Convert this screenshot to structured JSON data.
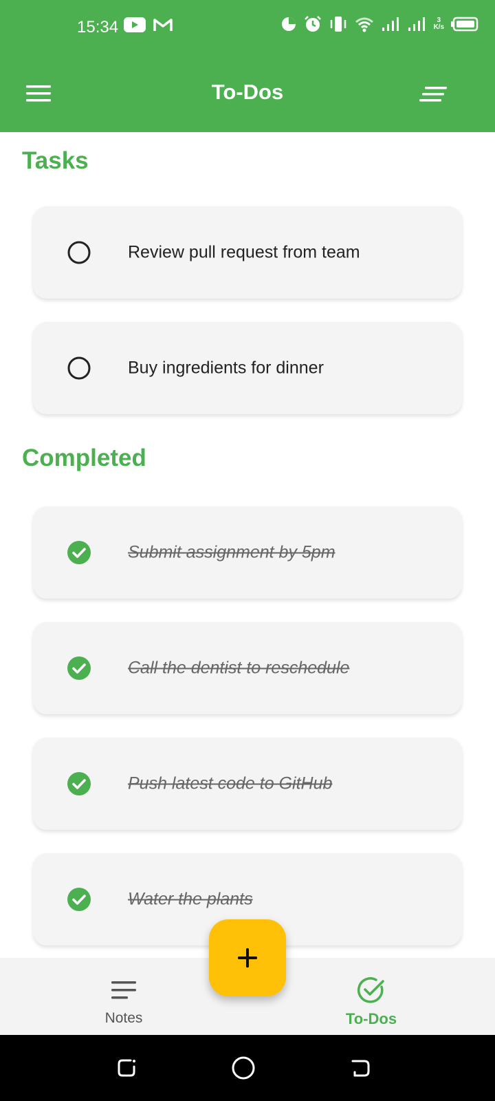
{
  "status_bar": {
    "time": "15:34",
    "net_speed_top": "3",
    "net_speed_bottom": "K/s",
    "icons": [
      "youtube-icon",
      "gmail-icon",
      "data-saver-icon",
      "alarm-icon",
      "vibrate-icon",
      "wifi-icon",
      "signal-icon",
      "signal-icon",
      "battery-icon"
    ]
  },
  "app_bar": {
    "title": "To-Dos",
    "menu_icon": "hamburger-menu-icon",
    "sort_icon": "sort-icon"
  },
  "sections": {
    "tasks_title": "Tasks",
    "completed_title": "Completed"
  },
  "tasks": [
    {
      "label": "Review pull request from team",
      "done": false
    },
    {
      "label": "Buy ingredients for dinner",
      "done": false
    }
  ],
  "completed": [
    {
      "label": "Submit assignment by 5pm",
      "done": true
    },
    {
      "label": "Call the dentist to reschedule",
      "done": true
    },
    {
      "label": "Push latest code to GitHub",
      "done": true
    },
    {
      "label": "Water the plants",
      "done": true
    }
  ],
  "bottom_nav": {
    "notes_label": "Notes",
    "todos_label": "To-Dos",
    "active": "To-Dos"
  },
  "fab": {
    "icon": "plus-icon"
  },
  "colors": {
    "primary": "#4caf50",
    "fab": "#ffc107",
    "card": "#f4f4f4"
  }
}
